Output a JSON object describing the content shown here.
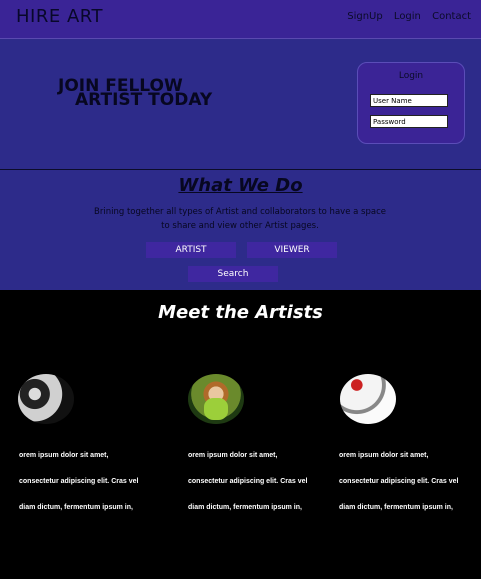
{
  "nav": {
    "brand": "HIRE ART",
    "links": [
      "SignUp",
      "Login",
      "Contact"
    ]
  },
  "hero": {
    "title_line1": "JOIN FELLOW",
    "title_line2": "ARTIST TODAY",
    "login": {
      "title": "Login",
      "username_value": "User Name",
      "password_value": "Password"
    }
  },
  "about": {
    "title": "What We Do",
    "text": "Brining together all types of Artist and collaborators to have a space to share and view other Artist pages.",
    "buttons": {
      "artist": "ARTIST",
      "viewer": "VIEWER",
      "search": "Search"
    }
  },
  "artists": {
    "title": "Meet the Artists",
    "cards": [
      {
        "lines": [
          "orem ipsum dolor sit amet,",
          "consectetur adipiscing elit. Cras vel",
          "diam dictum, fermentum ipsum in,"
        ]
      },
      {
        "lines": [
          "orem ipsum dolor sit amet,",
          "consectetur adipiscing elit. Cras vel",
          "diam dictum, fermentum ipsum in,"
        ]
      },
      {
        "lines": [
          "orem ipsum dolor sit amet,",
          "consectetur adipiscing elit. Cras vel",
          "diam dictum, fermentum ipsum in,"
        ]
      }
    ]
  },
  "colors": {
    "nav": "#3a2496",
    "hero": "#2d2b8a",
    "button": "#3f27a0",
    "background": "#000000"
  }
}
